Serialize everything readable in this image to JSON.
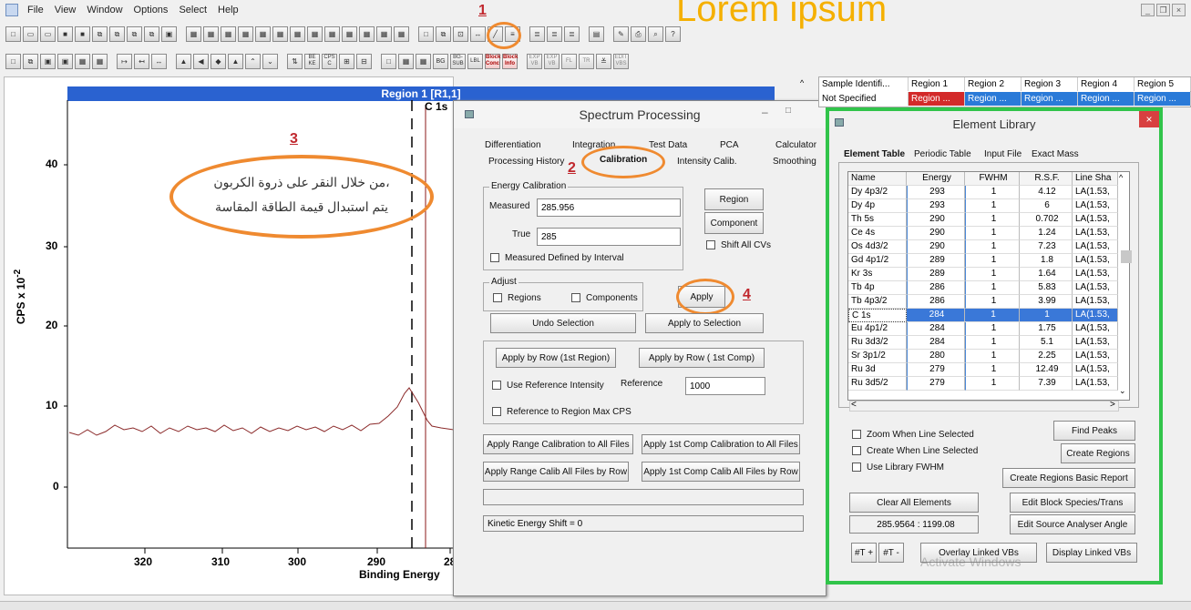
{
  "menu": {
    "items": [
      "File",
      "View",
      "Window",
      "Options",
      "Select",
      "Help"
    ]
  },
  "brand": {
    "text": "Lorem ipsum"
  },
  "annotations": {
    "n1": "1",
    "n2": "2",
    "n3": "3",
    "n4": "4",
    "arabic_line1": "،من خلال النقر على ذروة الكربون",
    "arabic_line2": "يتم استبدال قيمة الطاقة المقاسة"
  },
  "toolbar2_labels": {
    "be": "BE\nKE",
    "cps": "CPS\nC",
    "block_conc": "Block\nConc",
    "block_info": "Block\nInfo",
    "bg": "BG",
    "bgsub": "BG-\nSUB",
    "lbl": "LBL",
    "exp_vb": "EXP\nVB",
    "exp_vb2": "EXP\nVB",
    "edit_vbs": "EDIT\nVBS",
    "tr": "TR",
    "fl": "FL"
  },
  "plot": {
    "title": "Region 1 [R1,1]",
    "peak_label": "C 1s",
    "ylabel": "CPS x 10",
    "yexp": "-2",
    "xlabel": "Binding Energy",
    "yticks": [
      "40",
      "30",
      "20",
      "10",
      "0"
    ],
    "xticks": [
      "320",
      "310",
      "300",
      "290",
      "28"
    ]
  },
  "spectrum": {
    "title": "Spectrum Processing",
    "tabs_row1": [
      "Differentiation",
      "Integration",
      "Test Data",
      "PCA",
      "Calculator"
    ],
    "tabs_row2": [
      "Processing History",
      "Calibration",
      "Intensity Calib.",
      "Smoothing"
    ],
    "energy_group": "Energy Calibration",
    "measured_label": "Measured",
    "measured_value": "285.956",
    "true_label": "True",
    "true_value": "285",
    "region_btn": "Region",
    "component_btn": "Component",
    "shift_all": "Shift All CVs",
    "measured_interval": "Measured Defined by Interval",
    "adjust_group": "Adjust",
    "regions": "Regions",
    "components": "Components",
    "apply": "Apply",
    "undo": "Undo Selection",
    "apply_sel": "Apply to Selection",
    "apply_row_region": "Apply by Row (1st Region)",
    "apply_row_comp": "Apply by Row ( 1st Comp)",
    "use_ref": "Use Reference Intensity",
    "reference_label": "Reference",
    "reference_value": "1000",
    "ref_max": "Reference to Region Max CPS",
    "range_all": "Apply Range Calibration to All Files",
    "comp_all": "Apply 1st Comp Calibration to All Files",
    "range_row": "Apply Range Calib All Files by Row",
    "comp_row": "Apply 1st Comp Calib All Files by Row",
    "ke_shift": "Kinetic Energy Shift = 0"
  },
  "regions_grid": {
    "headers": [
      "Sample Identifi...",
      "Region 1",
      "Region 2",
      "Region 3",
      "Region 4",
      "Region 5"
    ],
    "row": [
      "Not Specified",
      "Region ...",
      "Region ...",
      "Region ...",
      "Region ...",
      "Region ..."
    ]
  },
  "elib": {
    "title": "Element Library",
    "tabs": [
      "Element Table",
      "Periodic Table",
      "Input File",
      "Exact Mass"
    ],
    "columns": [
      "Name",
      "Energy",
      "FWHM",
      "R.S.F.",
      "Line Sha"
    ],
    "rows": [
      [
        "Dy 4p3/2",
        "293",
        "1",
        "4.12",
        "LA(1.53,"
      ],
      [
        "Dy 4p",
        "293",
        "1",
        "6",
        "LA(1.53,"
      ],
      [
        "Th 5s",
        "290",
        "1",
        "0.702",
        "LA(1.53,"
      ],
      [
        "Ce 4s",
        "290",
        "1",
        "1.24",
        "LA(1.53,"
      ],
      [
        "Os 4d3/2",
        "290",
        "1",
        "7.23",
        "LA(1.53,"
      ],
      [
        "Gd 4p1/2",
        "289",
        "1",
        "1.8",
        "LA(1.53,"
      ],
      [
        "Kr 3s",
        "289",
        "1",
        "1.64",
        "LA(1.53,"
      ],
      [
        "Tb 4p",
        "286",
        "1",
        "5.83",
        "LA(1.53,"
      ],
      [
        "Tb 4p3/2",
        "286",
        "1",
        "3.99",
        "LA(1.53,"
      ],
      [
        "C 1s",
        "284",
        "1",
        "1",
        "LA(1.53,"
      ],
      [
        "Eu 4p1/2",
        "284",
        "1",
        "1.75",
        "LA(1.53,"
      ],
      [
        "Ru 3d3/2",
        "284",
        "1",
        "5.1",
        "LA(1.53,"
      ],
      [
        "Sr 3p1/2",
        "280",
        "1",
        "2.25",
        "LA(1.53,"
      ],
      [
        "Ru 3d",
        "279",
        "1",
        "12.49",
        "LA(1.53,"
      ],
      [
        "Ru 3d5/2",
        "279",
        "1",
        "7.39",
        "LA(1.53,"
      ]
    ],
    "zoom": "Zoom When Line Selected",
    "create_when": "Create When Line Selected",
    "use_fwhm": "Use Library FWHM",
    "find_peaks": "Find Peaks",
    "create_regions": "Create Regions",
    "create_report": "Create Regions Basic Report",
    "clear": "Clear All Elements",
    "edit_block": "Edit Block Species/Trans",
    "readout": "285.9564 : 1199.08",
    "edit_source": "Edit Source Analyser Angle",
    "t_plus": "#T +",
    "t_minus": "#T -",
    "overlay": "Overlay Linked VBs",
    "display_linked": "Display Linked VBs",
    "watermark": "Activate Windows"
  }
}
